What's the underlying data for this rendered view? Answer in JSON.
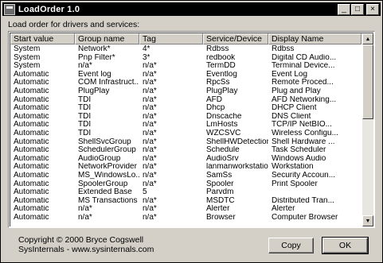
{
  "window": {
    "title": "LoadOrder 1.0"
  },
  "title_buttons": {
    "minimize": "_",
    "maximize": "□",
    "close": "×"
  },
  "description": "Load order for drivers and services:",
  "table": {
    "headers": [
      "Start value",
      "Group name",
      "Tag",
      "Service/Device",
      "Display Name"
    ],
    "rows": [
      [
        "System",
        "Network*",
        "4*",
        "Rdbss",
        "Rdbss"
      ],
      [
        "System",
        "Pnp Filter*",
        "3*",
        "redbook",
        "Digital CD Audio..."
      ],
      [
        "System",
        "n/a*",
        "n/a*",
        "TermDD",
        "Terminal Device..."
      ],
      [
        "Automatic",
        "Event log",
        "n/a*",
        "Eventlog",
        "Event Log"
      ],
      [
        "Automatic",
        "COM Infrastruct...",
        "n/a*",
        "RpcSs",
        "Remote Proced..."
      ],
      [
        "Automatic",
        "PlugPlay",
        "n/a*",
        "PlugPlay",
        "Plug and Play"
      ],
      [
        "Automatic",
        "TDI",
        "n/a*",
        "AFD",
        "AFD Networking..."
      ],
      [
        "Automatic",
        "TDI",
        "n/a*",
        "Dhcp",
        "DHCP Client"
      ],
      [
        "Automatic",
        "TDI",
        "n/a*",
        "Dnscache",
        "DNS Client"
      ],
      [
        "Automatic",
        "TDI",
        "n/a*",
        "LmHosts",
        "TCP/IP NetBIO..."
      ],
      [
        "Automatic",
        "TDI",
        "n/a*",
        "WZCSVC",
        "Wireless Configu..."
      ],
      [
        "Automatic",
        "ShellSvcGroup",
        "n/a*",
        "ShellHWDetection",
        "Shell Hardware ..."
      ],
      [
        "Automatic",
        "SchedulerGroup",
        "n/a*",
        "Schedule",
        "Task Scheduler"
      ],
      [
        "Automatic",
        "AudioGroup",
        "n/a*",
        "AudioSrv",
        "Windows Audio"
      ],
      [
        "Automatic",
        "NetworkProvider",
        "n/a*",
        "lanmanworkstation",
        "Workstation"
      ],
      [
        "Automatic",
        "MS_WindowsLo...",
        "n/a*",
        "SamSs",
        "Security Accoun..."
      ],
      [
        "Automatic",
        "SpoolerGroup",
        "n/a*",
        "Spooler",
        "Print Spooler"
      ],
      [
        "Automatic",
        "Extended Base",
        "5",
        "Parvdm",
        ""
      ],
      [
        "Automatic",
        "MS Transactions",
        "n/a*",
        "MSDTC",
        "Distributed Tran..."
      ],
      [
        "Automatic",
        "n/a*",
        "n/a*",
        "Alerter",
        "Alerter"
      ],
      [
        "Automatic",
        "n/a*",
        "n/a*",
        "Browser",
        "Computer Browser"
      ]
    ]
  },
  "scrollbar": {
    "up": "▲",
    "down": "▼"
  },
  "footer": {
    "copyright_line1": "Copyright © 2000 Bryce Cogswell",
    "copyright_line2": "SysInternals - www.sysinternals.com"
  },
  "buttons": {
    "copy": "Copy",
    "ok": "OK"
  }
}
